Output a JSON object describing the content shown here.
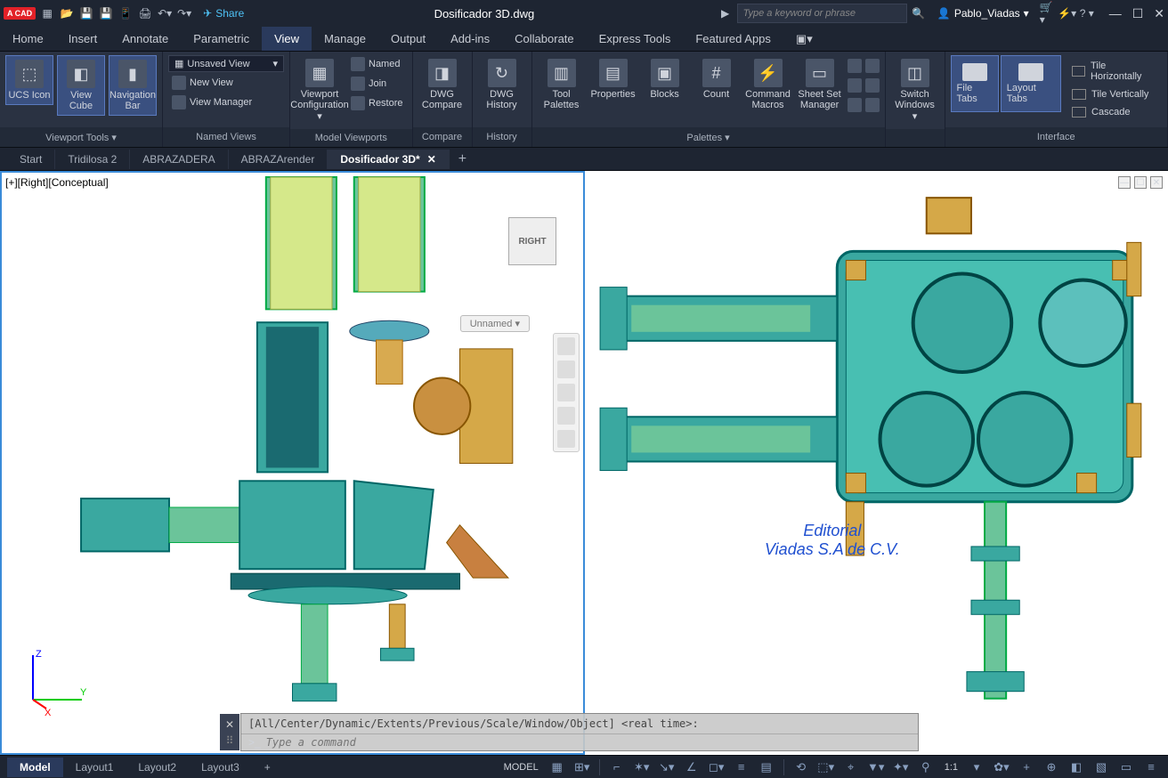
{
  "app": {
    "logo": "A CAD",
    "title": "Dosificador 3D.dwg",
    "search_placeholder": "Type a keyword or phrase",
    "share": "Share",
    "user": "Pablo_Viadas"
  },
  "menu": {
    "items": [
      "Home",
      "Insert",
      "Annotate",
      "Parametric",
      "View",
      "Manage",
      "Output",
      "Add-ins",
      "Collaborate",
      "Express Tools",
      "Featured Apps"
    ],
    "active": "View"
  },
  "ribbon": {
    "viewport_tools": {
      "label": "Viewport Tools ▾",
      "ucs": "UCS Icon",
      "cube": "View Cube",
      "nav": "Navigation Bar"
    },
    "named_views": {
      "label": "Named Views",
      "unsaved": "Unsaved View",
      "new": "New View",
      "mgr": "View Manager"
    },
    "model_viewports": {
      "label": "Model Viewports",
      "config": "Viewport Configuration ▾",
      "named": "Named",
      "join": "Join",
      "restore": "Restore"
    },
    "compare": {
      "label": "Compare",
      "btn": "DWG Compare"
    },
    "history": {
      "label": "History",
      "btn": "DWG History"
    },
    "palettes": {
      "label": "Palettes ▾",
      "tool": "Tool Palettes",
      "props": "Properties",
      "blocks": "Blocks",
      "count": "Count",
      "macros": "Command Macros",
      "sheet": "Sheet Set Manager"
    },
    "windows": {
      "switch": "Switch Windows ▾"
    },
    "interface": {
      "label": "Interface",
      "file_tabs": "File Tabs",
      "layout_tabs": "Layout Tabs",
      "tile_h": "Tile Horizontally",
      "tile_v": "Tile Vertically",
      "cascade": "Cascade"
    }
  },
  "doc_tabs": {
    "items": [
      "Start",
      "Tridilosa 2",
      "ABRAZADERA",
      "ABRAZArender"
    ],
    "active": "Dosificador 3D*"
  },
  "viewport": {
    "left_label": "[+][Right][Conceptual]",
    "cube": "RIGHT",
    "unnamed": "Unnamed ▾"
  },
  "watermark": {
    "l1": "Editorial",
    "l2": "Viadas S.A de C.V."
  },
  "cmd": {
    "history": "[All/Center/Dynamic/Extents/Previous/Scale/Window/Object] <real time>:",
    "placeholder": "Type a command",
    "prompt": ">_"
  },
  "layout_tabs": {
    "items": [
      "Model",
      "Layout1",
      "Layout2",
      "Layout3"
    ],
    "active": "Model"
  },
  "status": {
    "model": "MODEL",
    "scale": "1:1"
  }
}
